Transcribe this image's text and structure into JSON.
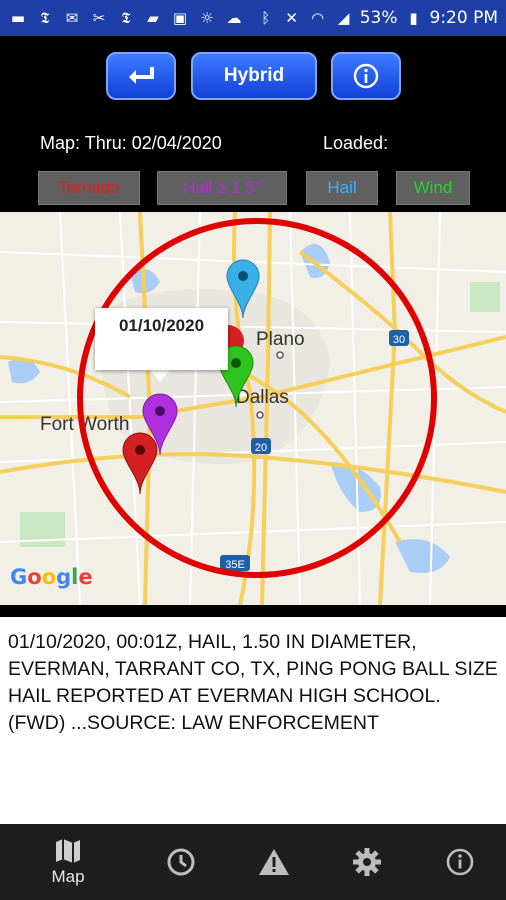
{
  "status_bar": {
    "battery": "53%",
    "time": "9:20 PM",
    "left_icons": [
      "chat-icon",
      "nyt-icon",
      "mail-icon",
      "nyt-icon",
      "nyt-icon",
      "message-icon",
      "image-icon",
      "weather-icon",
      "cloud-icon"
    ],
    "right_icons": [
      "bluetooth-icon",
      "mute-icon",
      "wifi-icon",
      "signal-icon",
      "battery-icon"
    ]
  },
  "toolbar": {
    "back_icon": "return-arrow-icon",
    "hybrid_label": "Hybrid",
    "info_icon": "info-icon"
  },
  "map_info": {
    "map_thru": "Map: Thru: 02/04/2020",
    "loaded": "Loaded:"
  },
  "filters": [
    {
      "label": "Tornado",
      "color": "#e02020"
    },
    {
      "label": "Hail ≥ 1.5\"",
      "color": "#b030d8"
    },
    {
      "label": "Hail",
      "color": "#3ab0ff"
    },
    {
      "label": "Wind",
      "color": "#26d12b"
    }
  ],
  "map": {
    "labels": {
      "plano": "Plano",
      "dallas": "Dallas",
      "fort_worth": "Fort Worth",
      "route_30": "30",
      "route_20": "20",
      "route_35e": "35E"
    },
    "callout": "01/10/2020",
    "google": "Google",
    "markers": [
      {
        "name": "hail-marker",
        "color": "#3ab0e8"
      },
      {
        "name": "tornado-marker-north",
        "color": "#d42020"
      },
      {
        "name": "wind-marker",
        "color": "#2ec41e"
      },
      {
        "name": "hail-large-marker",
        "color": "#b030e0"
      },
      {
        "name": "tornado-marker-south",
        "color": "#d42020"
      }
    ],
    "radius_color": "#e00000"
  },
  "report": {
    "text": "01/10/2020, 00:01Z, HAIL, 1.50 IN DIAMETER, EVERMAN, TARRANT CO, TX, PING PONG BALL SIZE HAIL REPORTED AT EVERMAN HIGH SCHOOL. (FWD) ...SOURCE: LAW ENFORCEMENT"
  },
  "bottom_nav": [
    {
      "icon": "map-icon",
      "label": "Map"
    },
    {
      "icon": "clock-icon",
      "label": ""
    },
    {
      "icon": "warning-icon",
      "label": ""
    },
    {
      "icon": "gear-icon",
      "label": ""
    },
    {
      "icon": "info-icon",
      "label": ""
    }
  ]
}
